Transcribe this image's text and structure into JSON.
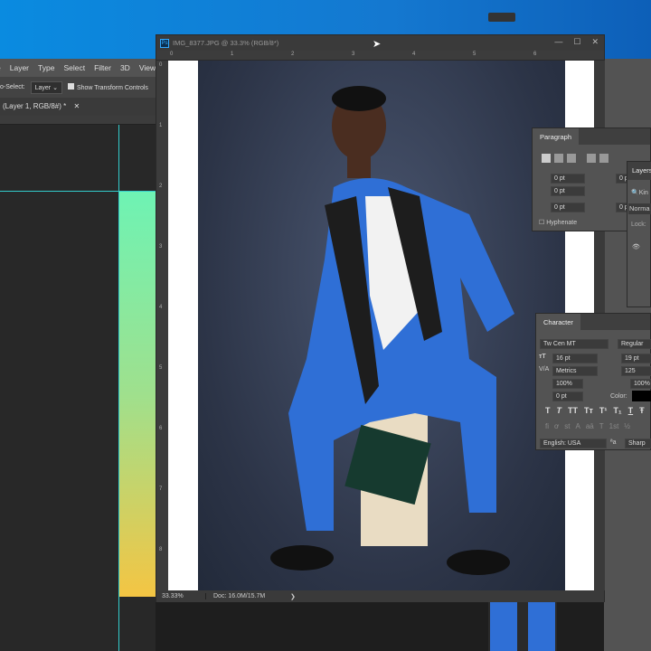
{
  "back_window": {
    "menu": [
      "Layer",
      "Type",
      "Select",
      "Filter",
      "3D",
      "View"
    ],
    "options": {
      "auto_select_label": "o-Select:",
      "auto_select_value": "Layer",
      "show_transform_controls": "Show Transform Controls",
      "show_transform_checked": true
    },
    "doc_tab": "(Layer 1, RGB/8#) *",
    "gradient_colors": [
      "#6ef3b4",
      "#f4c543"
    ],
    "guide_color": "#33cccc"
  },
  "front_window": {
    "title": "IMG_8377.JPG @ 33.3% (RGB/8*)",
    "ruler_top": [
      "0",
      "1",
      "2",
      "3",
      "4",
      "5",
      "6"
    ],
    "ruler_left": [
      "0",
      "1",
      "2",
      "3",
      "4",
      "5",
      "6",
      "7",
      "8"
    ],
    "status": {
      "zoom": "33.33%",
      "doc": "Doc: 16.0M/15.7M",
      "arrow": "❯"
    }
  },
  "paragraph_panel": {
    "tab": "Paragraph",
    "fields": [
      "0 pt",
      "0 pt",
      "0 pt",
      "0 p",
      "0 p"
    ],
    "hyphenate": "Hyphenate",
    "hyphenate_checked": false
  },
  "layers_panel": {
    "tab": "Layers",
    "search_placeholder": "Kin",
    "blend": "Norma",
    "lock": "Lock:"
  },
  "character_panel": {
    "tab": "Character",
    "font": "Tw Cen MT",
    "style": "Regular",
    "size": "16 pt",
    "leading": "19 pt",
    "kerning": "Metrics",
    "tracking": "125",
    "vscale": "100%",
    "hscale": "100%",
    "baseline": "0 pt",
    "color_label": "Color:",
    "color": "#000000",
    "type_buttons": [
      "T",
      "T",
      "TT",
      "Tт",
      "T¹",
      "T₁",
      "T",
      "Ŧ"
    ],
    "opentype_buttons": [
      "fi",
      "ơ",
      "st",
      "A",
      "aā",
      "T",
      "1st",
      "½"
    ],
    "language": "English: USA",
    "aa_icon": "ªa",
    "antialias": "Sharp"
  },
  "colors": {
    "desktop": "#0a8be0",
    "suit": "#2f6fd6",
    "panel": "#535353"
  }
}
